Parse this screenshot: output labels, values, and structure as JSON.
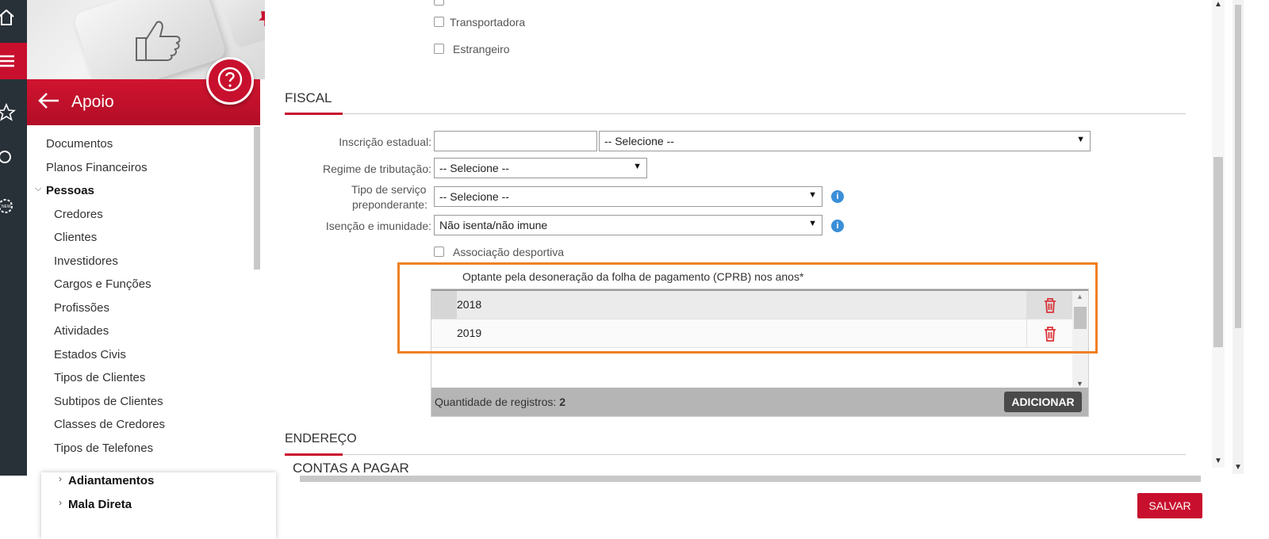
{
  "sidebar": {
    "header_title": "Apoio",
    "items": [
      {
        "label": "Documentos"
      },
      {
        "label": "Planos Financeiros"
      },
      {
        "label": "Pessoas"
      },
      {
        "label": "Credores"
      },
      {
        "label": "Clientes"
      },
      {
        "label": "Investidores"
      },
      {
        "label": "Cargos e Funções"
      },
      {
        "label": "Profissões"
      },
      {
        "label": "Atividades"
      },
      {
        "label": "Estados Civis"
      },
      {
        "label": "Tipos de Clientes"
      },
      {
        "label": "Subtipos de Clientes"
      },
      {
        "label": "Classes de Credores"
      },
      {
        "label": "Tipos de Telefones"
      }
    ],
    "bottom_items": [
      {
        "label": "Adiantamentos"
      },
      {
        "label": "Mala Direta"
      }
    ]
  },
  "form": {
    "checkboxes": [
      {
        "label": "Transportadora",
        "checked": false
      },
      {
        "label": "Estrangeiro",
        "checked": false
      }
    ],
    "fiscal": {
      "section_title": "FISCAL",
      "inscricao_label": "Inscrição estadual:",
      "inscricao_value": "",
      "inscricao_select": "-- Selecione --",
      "regime_label": "Regime de tributação:",
      "regime_value": "-- Selecione --",
      "tipo_servico_label_1": "Tipo de serviço",
      "tipo_servico_label_2": "preponderante:",
      "tipo_servico_value": "-- Selecione --",
      "isencao_label": "Isenção e imunidade:",
      "isencao_value": "Não isenta/não imune",
      "associacao_label": "Associação desportiva",
      "associacao_checked": false,
      "cprb": {
        "title": "Optante pela desoneração da folha de pagamento (CPRB) nos anos*",
        "rows": [
          {
            "value": "2018"
          },
          {
            "value": "2019"
          }
        ],
        "count_label": "Quantidade de registros:",
        "count_value": "2",
        "add_label": "ADICIONAR"
      }
    },
    "endereco_title": "ENDEREÇO",
    "contas_title": "CONTAS A PAGAR"
  },
  "actions": {
    "save_label": "SALVAR"
  },
  "colors": {
    "brand": "#c8102e",
    "highlight": "#f08024",
    "info": "#3a8fd8"
  }
}
